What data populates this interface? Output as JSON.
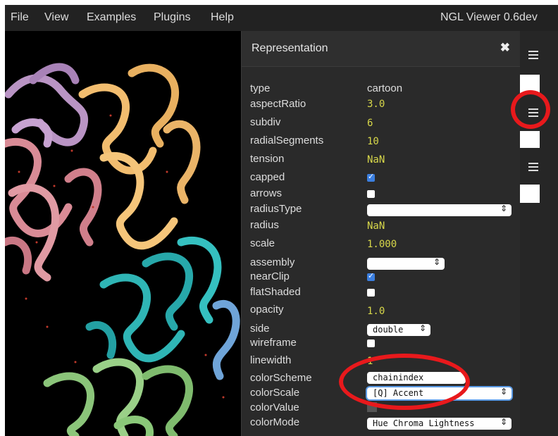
{
  "menu": {
    "items": [
      "File",
      "View",
      "Examples",
      "Plugins",
      "Help"
    ],
    "app_title": "NGL Viewer 0.6dev"
  },
  "panel": {
    "title": "Representation",
    "close_icon": "close-icon",
    "props": {
      "type": {
        "label": "type",
        "value": "cartoon"
      },
      "aspectRatio": {
        "label": "aspectRatio",
        "value": "3.0"
      },
      "subdiv": {
        "label": "subdiv",
        "value": "6"
      },
      "radialSegments": {
        "label": "radialSegments",
        "value": "10"
      },
      "tension": {
        "label": "tension",
        "value": "NaN"
      },
      "capped": {
        "label": "capped",
        "checked": true
      },
      "arrows": {
        "label": "arrows",
        "checked": false
      },
      "radiusType": {
        "label": "radiusType",
        "value": ""
      },
      "radius": {
        "label": "radius",
        "value": "NaN"
      },
      "scale": {
        "label": "scale",
        "value": "1.000"
      },
      "assembly": {
        "label": "assembly",
        "value": ""
      },
      "nearClip": {
        "label": "nearClip",
        "checked": true
      },
      "flatShaded": {
        "label": "flatShaded",
        "checked": false
      },
      "opacity": {
        "label": "opacity",
        "value": "1.0"
      },
      "side": {
        "label": "side",
        "value": "double"
      },
      "wireframe": {
        "label": "wireframe",
        "checked": false
      },
      "linewidth": {
        "label": "linewidth",
        "value": "1"
      },
      "colorScheme": {
        "label": "colorScheme",
        "value": "chainindex"
      },
      "colorScale": {
        "label": "colorScale",
        "value": "[Q] Accent"
      },
      "colorValue": {
        "label": "colorValue",
        "value": ""
      },
      "colorMode": {
        "label": "colorMode",
        "value": "Hue Chroma Lightness"
      }
    }
  },
  "sidebar": {
    "icons": [
      "menu-icon",
      "menu-icon",
      "menu-icon"
    ]
  },
  "colors": {
    "annotation_red": "#e8191c",
    "value_yellow": "#d8d84a",
    "checkbox_blue": "#3b7fe0"
  }
}
